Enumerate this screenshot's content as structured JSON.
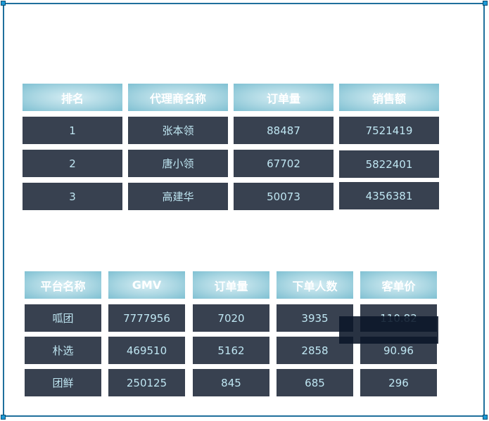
{
  "table1": {
    "headers": [
      "排名",
      "代理商名称",
      "订单量",
      "销售额"
    ],
    "rows": [
      [
        "1",
        "张本领",
        "88487",
        "7521419"
      ],
      [
        "2",
        "唐小领",
        "67702",
        "5822401"
      ],
      [
        "3",
        "高建华",
        "50073",
        "4356381"
      ]
    ]
  },
  "table2": {
    "headers": [
      "平台名称",
      "GMV",
      "订单量",
      "下单人数",
      "客单价"
    ],
    "rows": [
      [
        "呱团",
        "7777956",
        "7020",
        "3935",
        "110.82"
      ],
      [
        "朴选",
        "469510",
        "5162",
        "2858",
        "90.96"
      ],
      [
        "团鲜",
        "250125",
        "845",
        "685",
        "296"
      ]
    ]
  },
  "colors": {
    "frame": "#1f6f9c",
    "header": "#a9d6e2",
    "cell": "#384150",
    "cell_text": "#bfe6f2"
  }
}
